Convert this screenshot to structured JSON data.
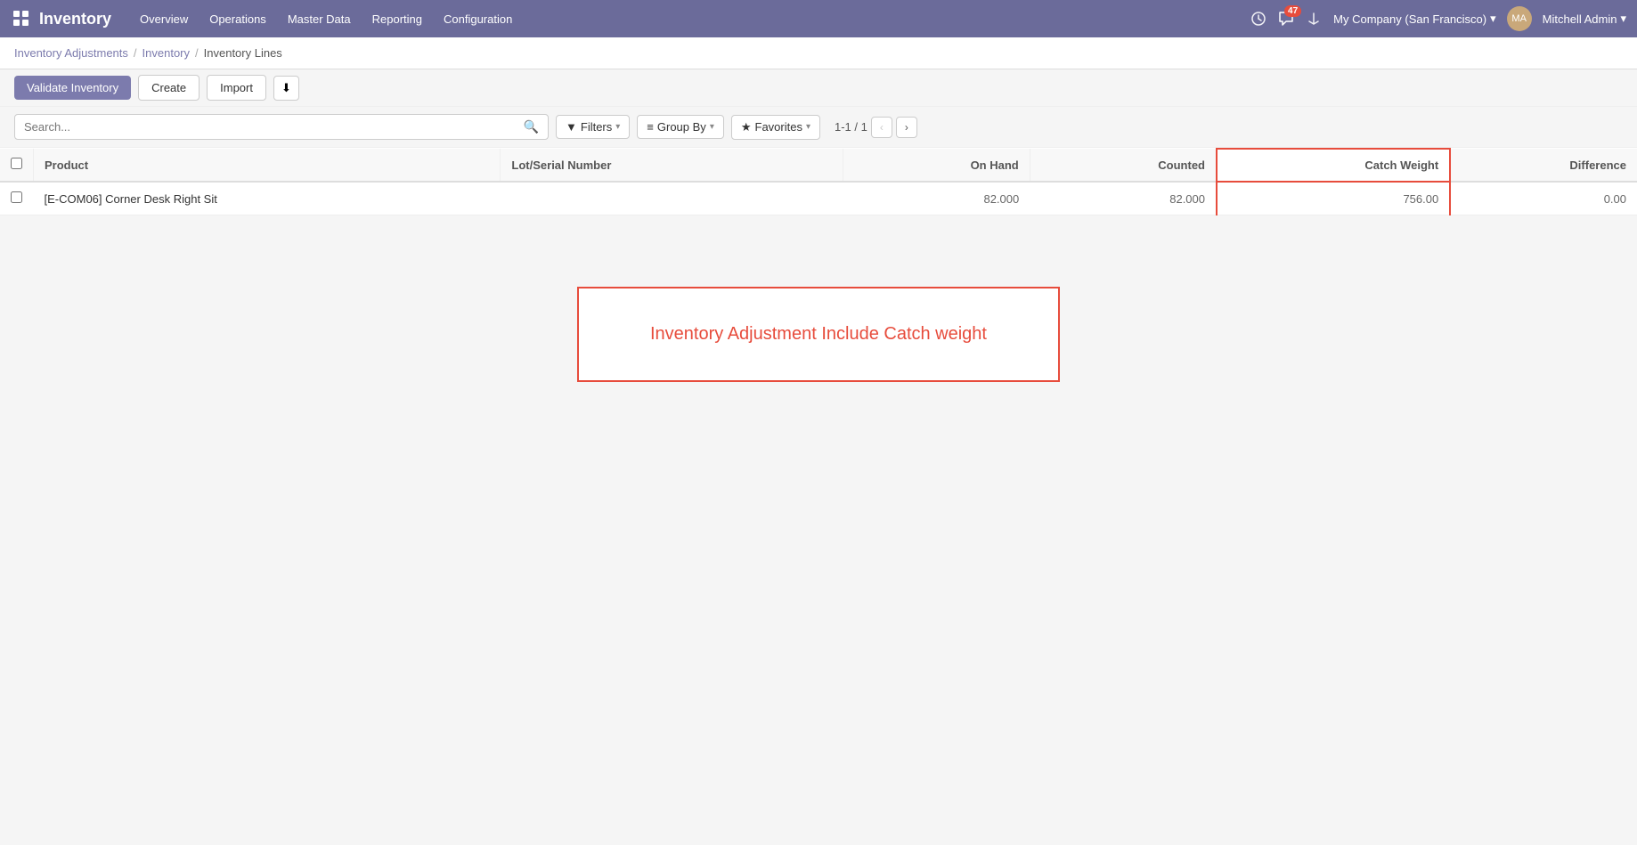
{
  "topbar": {
    "app_name": "Inventory",
    "nav_items": [
      "Overview",
      "Operations",
      "Master Data",
      "Reporting",
      "Configuration"
    ],
    "chat_count": "47",
    "company": "My Company (San Francisco)",
    "user": "Mitchell Admin"
  },
  "breadcrumb": {
    "parts": [
      "Inventory Adjustments",
      "Inventory",
      "Inventory Lines"
    ]
  },
  "toolbar": {
    "validate_label": "Validate Inventory",
    "create_label": "Create",
    "import_label": "Import",
    "download_icon": "⬇"
  },
  "searchbar": {
    "placeholder": "Search...",
    "filters_label": "Filters",
    "groupby_label": "Group By",
    "favorites_label": "Favorites"
  },
  "pagination": {
    "label": "1-1 / 1"
  },
  "table": {
    "columns": [
      "",
      "Product",
      "Lot/Serial Number",
      "On Hand",
      "Counted",
      "Catch Weight",
      "Difference"
    ],
    "rows": [
      {
        "product": "[E-COM06] Corner Desk Right Sit",
        "lot": "",
        "on_hand": "82.000",
        "counted": "82.000",
        "catch_weight": "756.00",
        "difference": "0.00"
      }
    ]
  },
  "annotation": {
    "text": "Inventory Adjustment Include Catch weight"
  }
}
